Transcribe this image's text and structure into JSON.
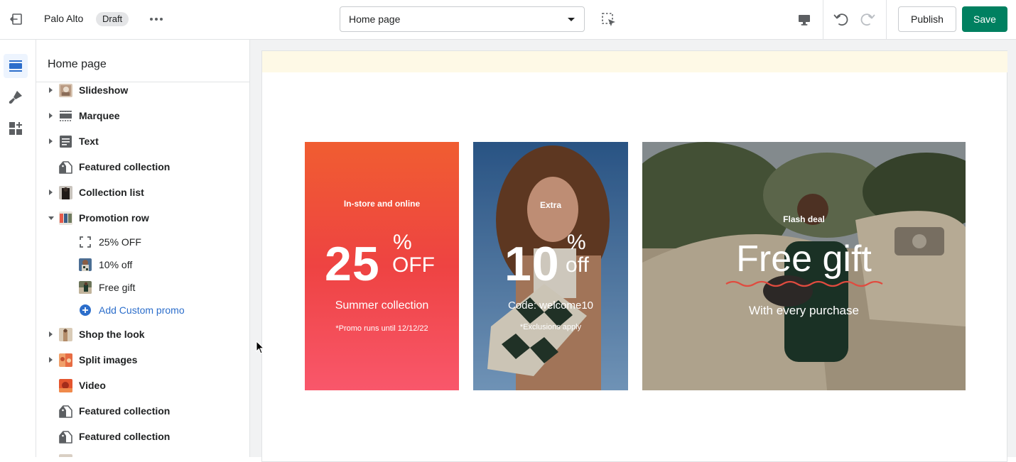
{
  "topbar": {
    "store_name": "Palo Alto",
    "status_badge": "Draft",
    "page_select_value": "Home page",
    "publish_label": "Publish",
    "save_label": "Save",
    "icons": [
      "exit-icon",
      "more-horizontal-icon",
      "select-inspector-icon",
      "desktop-icon",
      "undo-icon",
      "redo-icon"
    ]
  },
  "rail": {
    "items": [
      {
        "name": "sections",
        "icon": "sections-icon",
        "active": true
      },
      {
        "name": "theme-settings",
        "icon": "paintbrush-icon",
        "active": false
      },
      {
        "name": "apps",
        "icon": "apps-icon",
        "active": false
      }
    ]
  },
  "sidebar": {
    "title": "Home page",
    "items": [
      {
        "label": "Slideshow",
        "icon": "image-thumb-icon",
        "expandable": true
      },
      {
        "label": "Marquee",
        "icon": "marquee-icon",
        "expandable": true
      },
      {
        "label": "Text",
        "icon": "text-icon",
        "expandable": true
      },
      {
        "label": "Featured collection",
        "icon": "tag-icon",
        "expandable": false
      },
      {
        "label": "Collection list",
        "icon": "image-thumb-icon",
        "expandable": true
      },
      {
        "label": "Promotion row",
        "icon": "image-thumb-icon",
        "expandable": true,
        "expanded": true
      },
      {
        "label": "25% OFF",
        "icon": "dashed-square-icon",
        "child": true
      },
      {
        "label": "10% off",
        "icon": "image-thumb-icon",
        "child": true
      },
      {
        "label": "Free gift",
        "icon": "image-thumb-icon",
        "child": true
      },
      {
        "label": "Add Custom promo",
        "icon": "plus-circle-icon",
        "child": true
      },
      {
        "label": "Shop the look",
        "icon": "image-thumb-icon",
        "expandable": true
      },
      {
        "label": "Split images",
        "icon": "image-thumb-icon",
        "expandable": true
      },
      {
        "label": "Video",
        "icon": "image-thumb-icon",
        "expandable": false
      },
      {
        "label": "Featured collection",
        "icon": "tag-icon",
        "expandable": false
      },
      {
        "label": "Featured collection",
        "icon": "tag-icon",
        "expandable": false
      }
    ]
  },
  "preview": {
    "promos": [
      {
        "eyebrow": "In-store and online",
        "number": "25",
        "symbol": "%",
        "unit": "OFF",
        "subtitle": "Summer collection",
        "note": "*Promo runs until 12/12/22"
      },
      {
        "eyebrow": "Extra",
        "number": "10",
        "symbol": "%",
        "unit": "off",
        "subtitle": "Code: welcome10",
        "note": "*Exclusions apply"
      },
      {
        "eyebrow": "Flash deal",
        "headline": "Free gift",
        "subtitle": "With every purchase"
      }
    ]
  },
  "colors": {
    "save_green": "#008060",
    "link_blue": "#2c6ecb",
    "announcement_bg": "#fef9e6",
    "promo_red_top": "#f05d31",
    "promo_red_bottom": "#f9576b"
  }
}
